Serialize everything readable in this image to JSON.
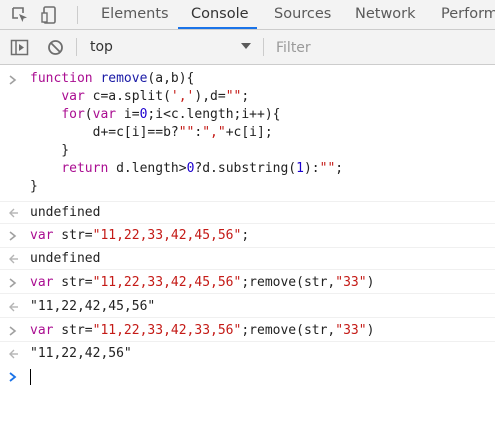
{
  "tabs": [
    {
      "label": "Elements",
      "active": false
    },
    {
      "label": "Console",
      "active": true
    },
    {
      "label": "Sources",
      "active": false
    },
    {
      "label": "Network",
      "active": false
    },
    {
      "label": "Performa",
      "active": false
    }
  ],
  "toolbar": {
    "context": "top",
    "filter_placeholder": "Filter"
  },
  "icons": {
    "inspect": "inspect-element-icon",
    "device": "device-toolbar-icon",
    "sidebar": "console-sidebar-icon",
    "clear": "clear-console-icon",
    "dropdown": "dropdown-arrow-icon",
    "prompt": "chevron-right-icon",
    "result": "result-arrow-icon"
  },
  "colors": {
    "accent": "#1a73e8",
    "keyword": "#aa0d91",
    "function_name": "#1a1aa6",
    "string": "#c41a16",
    "number": "#1c00cf",
    "undefined": "#808080"
  },
  "console": {
    "entry1": {
      "l1_kw": "function",
      "l1_name": " remove",
      "l1_rest": "(a,b){",
      "l2_indent": "    ",
      "l2_kw": "var",
      "l2_a": " c=a.split(",
      "l2_s1": "','",
      "l2_b": "),d=",
      "l2_s2": "\"\"",
      "l2_c": ";",
      "l3_indent": "    ",
      "l3_kw1": "for",
      "l3_a": "(",
      "l3_kw2": "var",
      "l3_b": " i=",
      "l3_n0": "0",
      "l3_c": ";i<c.length;i++){",
      "l4_indent": "        ",
      "l4_a": "d+=c[i]==b?",
      "l4_s1": "\"\"",
      "l4_b": ":",
      "l4_s2": "\",\"",
      "l4_c": "+c[i];",
      "l5": "    }",
      "l6_indent": "    ",
      "l6_kw": "return",
      "l6_a": " d.length>",
      "l6_n0": "0",
      "l6_b": "?d.substring(",
      "l6_n1": "1",
      "l6_c": "):",
      "l6_s": "\"\"",
      "l6_d": ";",
      "l7": "}"
    },
    "result1": "undefined",
    "entry2": {
      "kw": "var",
      "a": " str=",
      "s": "\"11,22,33,42,45,56\"",
      "b": ";"
    },
    "result2": "undefined",
    "entry3": {
      "kw": "var",
      "a": " str=",
      "s1": "\"11,22,33,42,45,56\"",
      "b": ";remove(str,",
      "s2": "\"33\"",
      "c": ")"
    },
    "result3": "\"11,22,42,45,56\"",
    "entry4": {
      "kw": "var",
      "a": " str=",
      "s1": "\"11,22,33,42,33,56\"",
      "b": ";remove(str,",
      "s2": "\"33\"",
      "c": ")"
    },
    "result4": "\"11,22,42,56\""
  }
}
